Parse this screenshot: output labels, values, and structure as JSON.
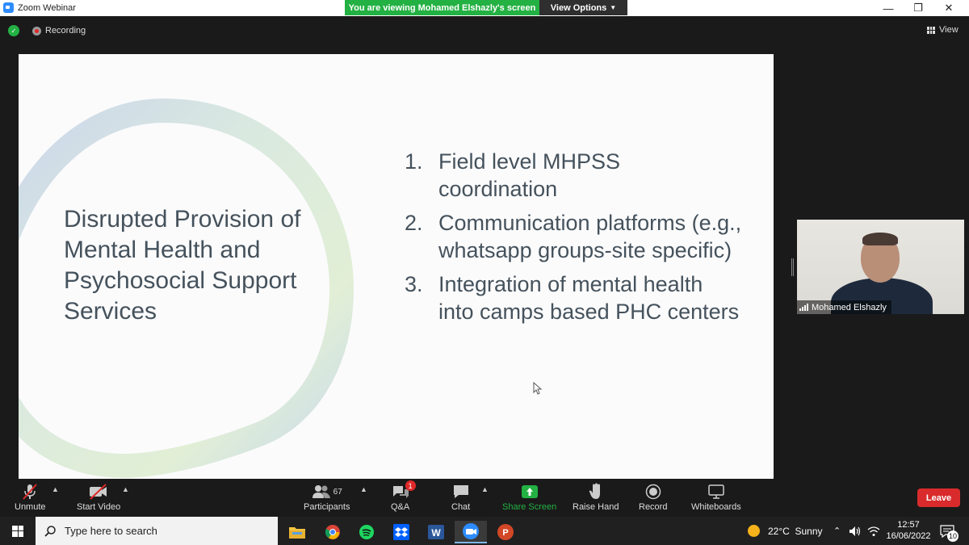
{
  "window": {
    "title": "Zoom Webinar",
    "banner": "You are viewing Mohamed Elshazly's screen",
    "view_options": "View Options",
    "minimize": "—",
    "restore": "❐",
    "close": "✕"
  },
  "meeting": {
    "recording_label": "Recording",
    "view_label": "View"
  },
  "slide": {
    "title": "Disrupted Provision of Mental Health and Psychosocial Support Services",
    "items": [
      {
        "num": "1.",
        "text": "Field level MHPSS coordination"
      },
      {
        "num": "2.",
        "text": "Communication platforms (e.g., whatsapp groups-site specific)"
      },
      {
        "num": "3.",
        "text": "Integration of mental health into camps based PHC centers"
      }
    ]
  },
  "video": {
    "participant_name": "Mohamed Elshazly"
  },
  "toolbar": {
    "unmute": "Unmute",
    "start_video": "Start Video",
    "participants": "Participants",
    "participants_count": "67",
    "qa": "Q&A",
    "qa_badge": "1",
    "chat": "Chat",
    "share_screen": "Share Screen",
    "raise_hand": "Raise Hand",
    "record": "Record",
    "whiteboards": "Whiteboards",
    "leave": "Leave"
  },
  "taskbar": {
    "search_placeholder": "Type here to search",
    "weather": "22°C  Sunny",
    "time": "12:57",
    "date": "16/06/2022",
    "notifications": "10",
    "apps": [
      "file-explorer",
      "chrome",
      "spotify",
      "dropbox",
      "word",
      "zoom",
      "powerpoint"
    ]
  },
  "colors": {
    "green": "#23b143",
    "leave_red": "#d92b2b",
    "slide_bg": "#fbfbfc",
    "slide_text": "#45525c",
    "zoom_blue": "#2d8cff"
  }
}
